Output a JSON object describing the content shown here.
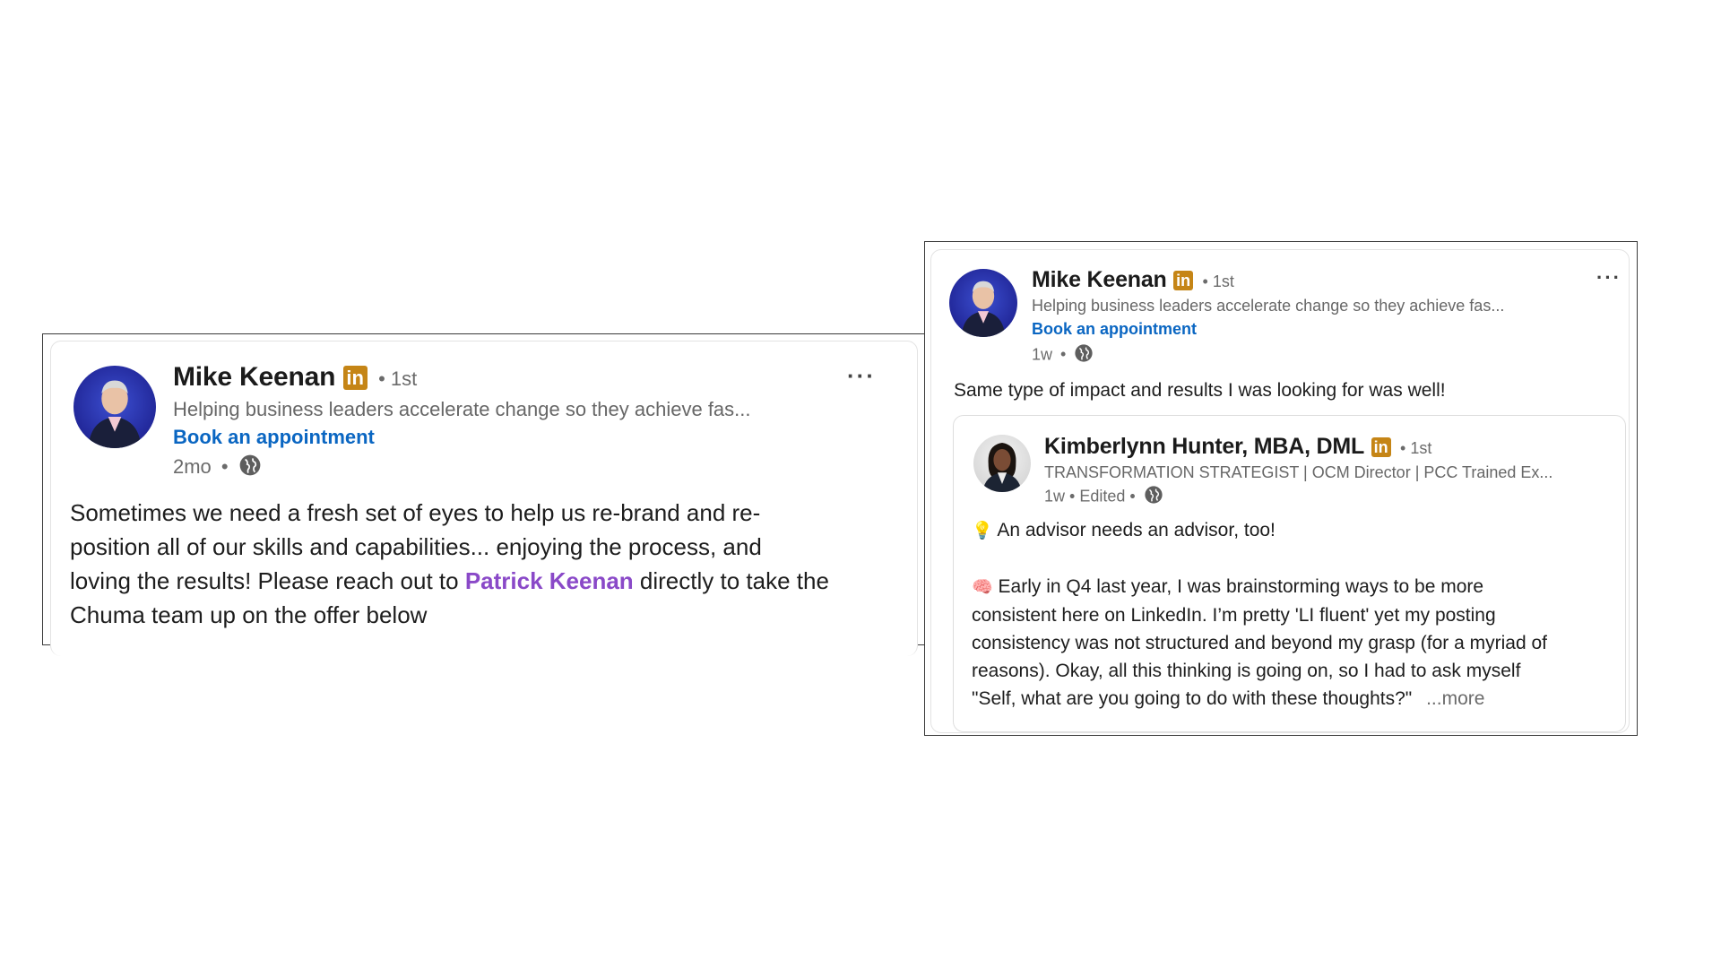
{
  "left_post": {
    "author": {
      "name": "Mike Keenan",
      "badge": "in",
      "degree": "• 1st",
      "headline": "Helping business leaders accelerate change so they achieve fas...",
      "cta": "Book an appointment",
      "time": "2mo",
      "separator": "•"
    },
    "body": {
      "line1": "Sometimes we need a fresh set of eyes to help us re-brand and re-",
      "line2": "position all of our skills and capabilities... enjoying the process, and",
      "line3_before": "loving the results! Please reach out to ",
      "mention": "Patrick Keenan",
      "line3_after": " directly to take the",
      "line4": "Chuma team up on the offer below"
    },
    "menu": "···"
  },
  "right_post": {
    "author": {
      "name": "Mike Keenan",
      "badge": "in",
      "degree": "• 1st",
      "headline": "Helping business leaders accelerate change so they achieve fas...",
      "cta": "Book an appointment",
      "time": "1w",
      "separator": "•"
    },
    "menu": "···",
    "comment": "Same type of impact and results I was looking for was well!",
    "shared": {
      "name": "Kimberlynn Hunter, MBA, DML",
      "badge": "in",
      "degree": "• 1st",
      "headline": "TRANSFORMATION STRATEGIST | OCM Director | PCC Trained Ex...",
      "meta": "1w • Edited •",
      "emoji1": "💡",
      "line1": "An advisor needs an advisor, too!",
      "emoji2": "🧠",
      "line2": "Early in Q4 last year, I was brainstorming ways to be more",
      "line3": "consistent here on LinkedIn. I’m pretty 'LI fluent' yet my posting",
      "line4": "consistency was not structured and beyond my grasp (for a myriad of",
      "line5": "reasons). Okay, all this thinking is going on, so I had to ask myself",
      "line6": "\"Self, what are you going to do with these thoughts?\"",
      "more": "...more"
    }
  },
  "colors": {
    "badge": "#c58516",
    "link": "#0a66c2",
    "mention": "#8a49c8",
    "frame_border": "#3a3a3a"
  },
  "icons": [
    "linkedin-badge-icon",
    "globe-icon",
    "more-options-icon",
    "lightbulb-icon",
    "brain-icon"
  ]
}
